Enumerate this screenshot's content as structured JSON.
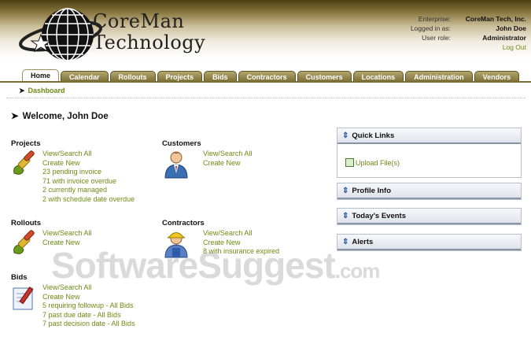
{
  "brand": {
    "line1": "CoreMan",
    "line2": "Technology"
  },
  "user": {
    "enterprise_label": "Enterprise:",
    "enterprise": "CoreMan Tech, Inc.",
    "logged_label": "Logged in as:",
    "logged": "John Doe",
    "role_label": "User role:",
    "role": "Administrator",
    "logout": "Log Out"
  },
  "tabs": [
    "Home",
    "Calendar",
    "Rollouts",
    "Projects",
    "Bids",
    "Contractors",
    "Customers",
    "Locations",
    "Administration",
    "Vendors"
  ],
  "breadcrumb": "Dashboard",
  "welcome": "Welcome, John Doe",
  "sections": {
    "projects": {
      "title": "Projects",
      "links": [
        "View/Search All",
        "Create New",
        "23 pending invoice",
        "71 with invoice overdue",
        "2 currently managed",
        "2 with schedule date overdue"
      ]
    },
    "customers": {
      "title": "Customers",
      "links": [
        "View/Search All",
        "Create New"
      ]
    },
    "rollouts": {
      "title": "Rollouts",
      "links": [
        "View/Search All",
        "Create New"
      ]
    },
    "contractors": {
      "title": "Contractors",
      "links": [
        "View/Search All",
        "Create New",
        "8 with insurance expired"
      ]
    },
    "bids": {
      "title": "Bids",
      "links": [
        "View/Search All",
        "Create New",
        "5 requiring followup - All Bids",
        "7 past due date - All Bids",
        "7 past decision date - All Bids"
      ]
    }
  },
  "panels": {
    "quick_links": {
      "title": "Quick Links",
      "item": "Upload File(s)"
    },
    "profile": {
      "title": "Profile Info"
    },
    "events": {
      "title": "Today's Events"
    },
    "alerts": {
      "title": "Alerts"
    }
  },
  "watermark": {
    "main": "SoftwareSuggest",
    "suffix": ".com"
  },
  "colors": {
    "link": "#6e8a12",
    "tab_bg": "#7c6f36",
    "panel_border": "#b7bfcc"
  }
}
